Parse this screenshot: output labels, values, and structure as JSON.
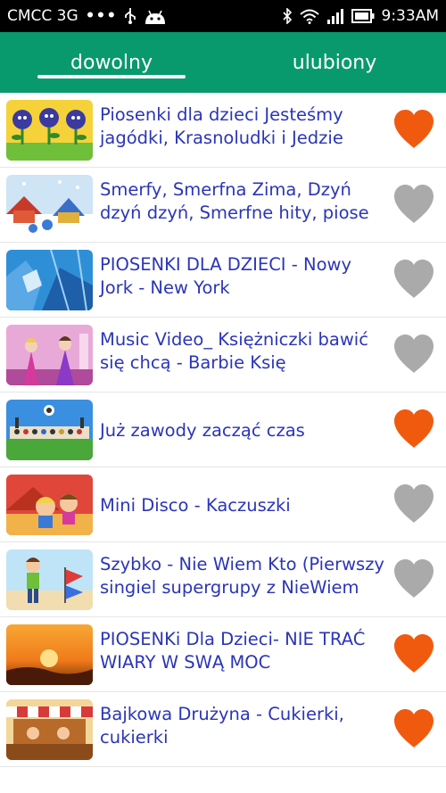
{
  "status_bar": {
    "carrier": "CMCC 3G",
    "dots": "•••",
    "time": "9:33AM"
  },
  "tabs": [
    {
      "label": "dowolny",
      "active": true
    },
    {
      "label": "ulubiony",
      "active": false
    }
  ],
  "colors": {
    "accent": "#089a6c",
    "title_text": "#2b35b8",
    "heart_favorite": "#f05a0f",
    "heart_default": "#aaaaaa"
  },
  "videos": [
    {
      "title": "Piosenki dla dzieci Jesteśmy jagódki, Krasnoludki i Jedzie",
      "favorite": true,
      "icon": "heart-icon"
    },
    {
      "title": "Smerfy, Smerfna Zima, Dzyń dzyń dzyń, Smerfne hity, piose",
      "favorite": false,
      "icon": "heart-icon"
    },
    {
      "title": "PIOSENKI DLA DZIECI - Nowy Jork - New York",
      "favorite": false,
      "icon": "heart-icon"
    },
    {
      "title": "Music Video_ Księżniczki bawić się chcą - Barbie Księ",
      "favorite": false,
      "icon": "heart-icon"
    },
    {
      "title": "Już zawody zacząć czas",
      "favorite": true,
      "icon": "heart-icon"
    },
    {
      "title": "Mini Disco - Kaczuszki",
      "favorite": false,
      "icon": "heart-icon"
    },
    {
      "title": "Szybko - Nie Wiem Kto (Pierwszy singiel supergrupy z NieWiem",
      "favorite": false,
      "icon": "heart-icon"
    },
    {
      "title": "PIOSENKi Dla Dzieci- NIE TRAĆ WIARY W SWĄ MOC",
      "favorite": true,
      "icon": "heart-icon"
    },
    {
      "title": "Bajkowa Drużyna - Cukierki, cukierki",
      "favorite": true,
      "icon": "heart-icon"
    }
  ]
}
